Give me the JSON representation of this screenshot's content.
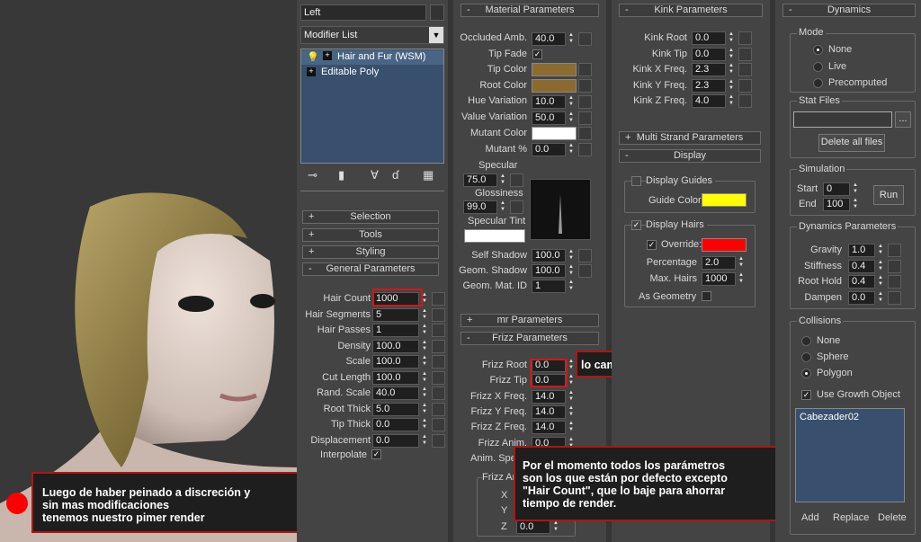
{
  "viewport": {
    "caption": "Luego de haber peinado a discreción y\nsin mas modificaciones\ntenemos nuestro pimer render"
  },
  "modify": {
    "object_name": "Left",
    "modifier_list_label": "Modifier List",
    "stack": [
      "Hair and Fur (WSM)",
      "Editable Poly"
    ]
  },
  "rollouts_left": {
    "selection": "Selection",
    "tools": "Tools",
    "styling": "Styling",
    "general": "General Parameters"
  },
  "general": [
    {
      "label": "Hair Count",
      "value": "1000"
    },
    {
      "label": "Hair Segments",
      "value": "5"
    },
    {
      "label": "Hair Passes",
      "value": "1"
    },
    {
      "label": "Density",
      "value": "100.0"
    },
    {
      "label": "Scale",
      "value": "100.0"
    },
    {
      "label": "Cut Length",
      "value": "100.0"
    },
    {
      "label": "Rand. Scale",
      "value": "40.0"
    },
    {
      "label": "Root Thick",
      "value": "5.0"
    },
    {
      "label": "Tip Thick",
      "value": "0.0"
    },
    {
      "label": "Displacement",
      "value": "0.0"
    }
  ],
  "interpolate_label": "Interpolate",
  "material": {
    "title": "Material Parameters",
    "occluded_label": "Occluded Amb.",
    "occluded_value": "40.0",
    "tipfade_label": "Tip Fade",
    "tipcolor_label": "Tip Color",
    "rootcolor_label": "Root Color",
    "huevar_label": "Hue Variation",
    "huevar_value": "10.0",
    "valvar_label": "Value Variation",
    "valvar_value": "50.0",
    "mutantcolor_label": "Mutant Color",
    "mutantpct_label": "Mutant %",
    "mutantpct_value": "0.0",
    "specular_label": "Specular",
    "specular_value": "75.0",
    "gloss_label": "Glossiness",
    "gloss_value": "99.0",
    "spectint_label": "Specular Tint",
    "selfshadow_label": "Self Shadow",
    "selfshadow_value": "100.0",
    "geomshadow_label": "Geom. Shadow",
    "geomshadow_value": "100.0",
    "geommat_label": "Geom. Mat. ID",
    "geommat_value": "1"
  },
  "mr_title": "mr Parameters",
  "frizz": {
    "title": "Frizz Parameters",
    "rows": [
      {
        "label": "Frizz Root",
        "value": "0.0"
      },
      {
        "label": "Frizz Tip",
        "value": "0.0"
      },
      {
        "label": "Frizz X Freq.",
        "value": "14.0"
      },
      {
        "label": "Frizz Y Freq.",
        "value": "14.0"
      },
      {
        "label": "Frizz Z Freq.",
        "value": "14.0"
      },
      {
        "label": "Frizz Anim.",
        "value": "0.0"
      },
      {
        "label": "Anim. Speed",
        "value": ""
      }
    ],
    "anim_group": "Frizz Anim. Dir.",
    "x": "X",
    "y": "Y",
    "z": "Z",
    "z_value": "0.0"
  },
  "callout_frizz": "lo cambié al principio",
  "callout_params": "Por el momento todos los parámetros\nson los que están por defecto excepto\n\"Hair Count\", que lo baje para ahorrar\ntiempo de render.",
  "kink": {
    "title": "Kink Parameters",
    "rows": [
      {
        "label": "Kink Root",
        "value": "0.0"
      },
      {
        "label": "Kink Tip",
        "value": "0.0"
      },
      {
        "label": "Kink X Freq.",
        "value": "2.3"
      },
      {
        "label": "Kink Y Freq.",
        "value": "2.3"
      },
      {
        "label": "Kink Z Freq.",
        "value": "4.0"
      }
    ]
  },
  "multistrand_title": "Multi Strand Parameters",
  "display": {
    "title": "Display",
    "guides_label": "Display Guides",
    "guide_color_label": "Guide Color",
    "hairs_label": "Display Hairs",
    "override_label": "Override:",
    "percentage_label": "Percentage",
    "percentage_value": "2.0",
    "maxhairs_label": "Max. Hairs",
    "maxhairs_value": "1000",
    "asgeom_label": "As Geometry"
  },
  "dynamics": {
    "title": "Dynamics",
    "mode_title": "Mode",
    "none": "None",
    "live": "Live",
    "precomputed": "Precomputed",
    "statfiles_title": "Stat Files",
    "statfiles_btn": "...",
    "delete_all": "Delete all files",
    "simulation_title": "Simulation",
    "start_label": "Start",
    "start_value": "0",
    "end_label": "End",
    "end_value": "100",
    "run": "Run",
    "dynparams_title": "Dynamics Parameters",
    "params": [
      {
        "label": "Gravity",
        "value": "1.0"
      },
      {
        "label": "Stiffness",
        "value": "0.4"
      },
      {
        "label": "Root Hold",
        "value": "0.4"
      },
      {
        "label": "Dampen",
        "value": "0.0"
      }
    ],
    "collisions_title": "Collisions",
    "c_none": "None",
    "c_sphere": "Sphere",
    "c_polygon": "Polygon",
    "use_growth": "Use Growth Object",
    "collision_item": "Cabezader02",
    "add": "Add",
    "replace": "Replace",
    "delete": "Delete"
  },
  "colors": {
    "tip": "#8c6c30",
    "root": "#8a6a2e",
    "mutant": "#ffffff",
    "spectint": "#ffffff",
    "guide": "#ffff00",
    "override": "#ff0000",
    "highlight": "#d01818"
  }
}
